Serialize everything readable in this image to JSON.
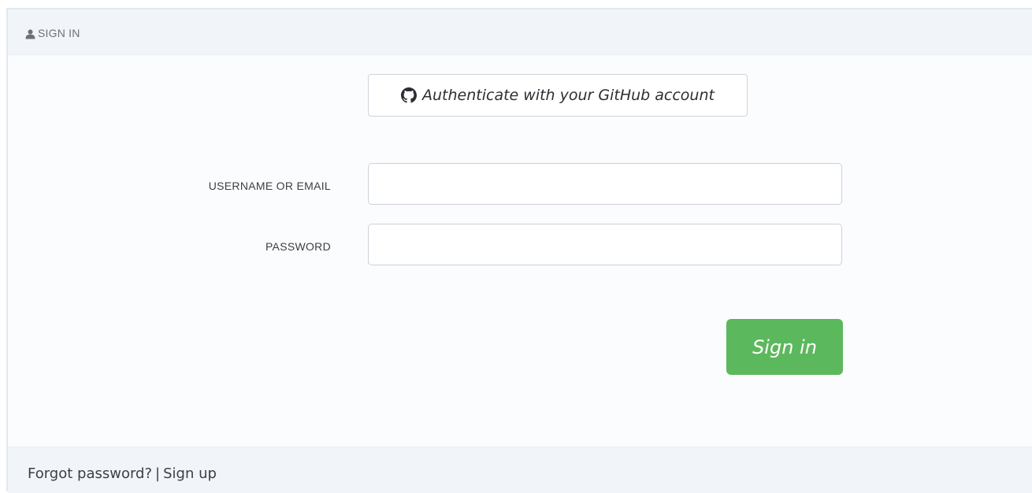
{
  "header": {
    "icon": "user-icon",
    "title": "SIGN IN"
  },
  "github": {
    "icon": "github-icon",
    "label": "Authenticate with your GitHub account"
  },
  "form": {
    "username_label": "USERNAME OR EMAIL",
    "username_value": "",
    "password_label": "PASSWORD",
    "password_value": "",
    "submit_label": "Sign in"
  },
  "footer": {
    "forgot_label": "Forgot password?",
    "separator": "|",
    "signup_label": "Sign up"
  },
  "colors": {
    "submit_bg": "#5cb85c",
    "panel_bg": "#fbfcfe",
    "header_bg": "#f1f5f9",
    "text": "#3a3f44"
  }
}
